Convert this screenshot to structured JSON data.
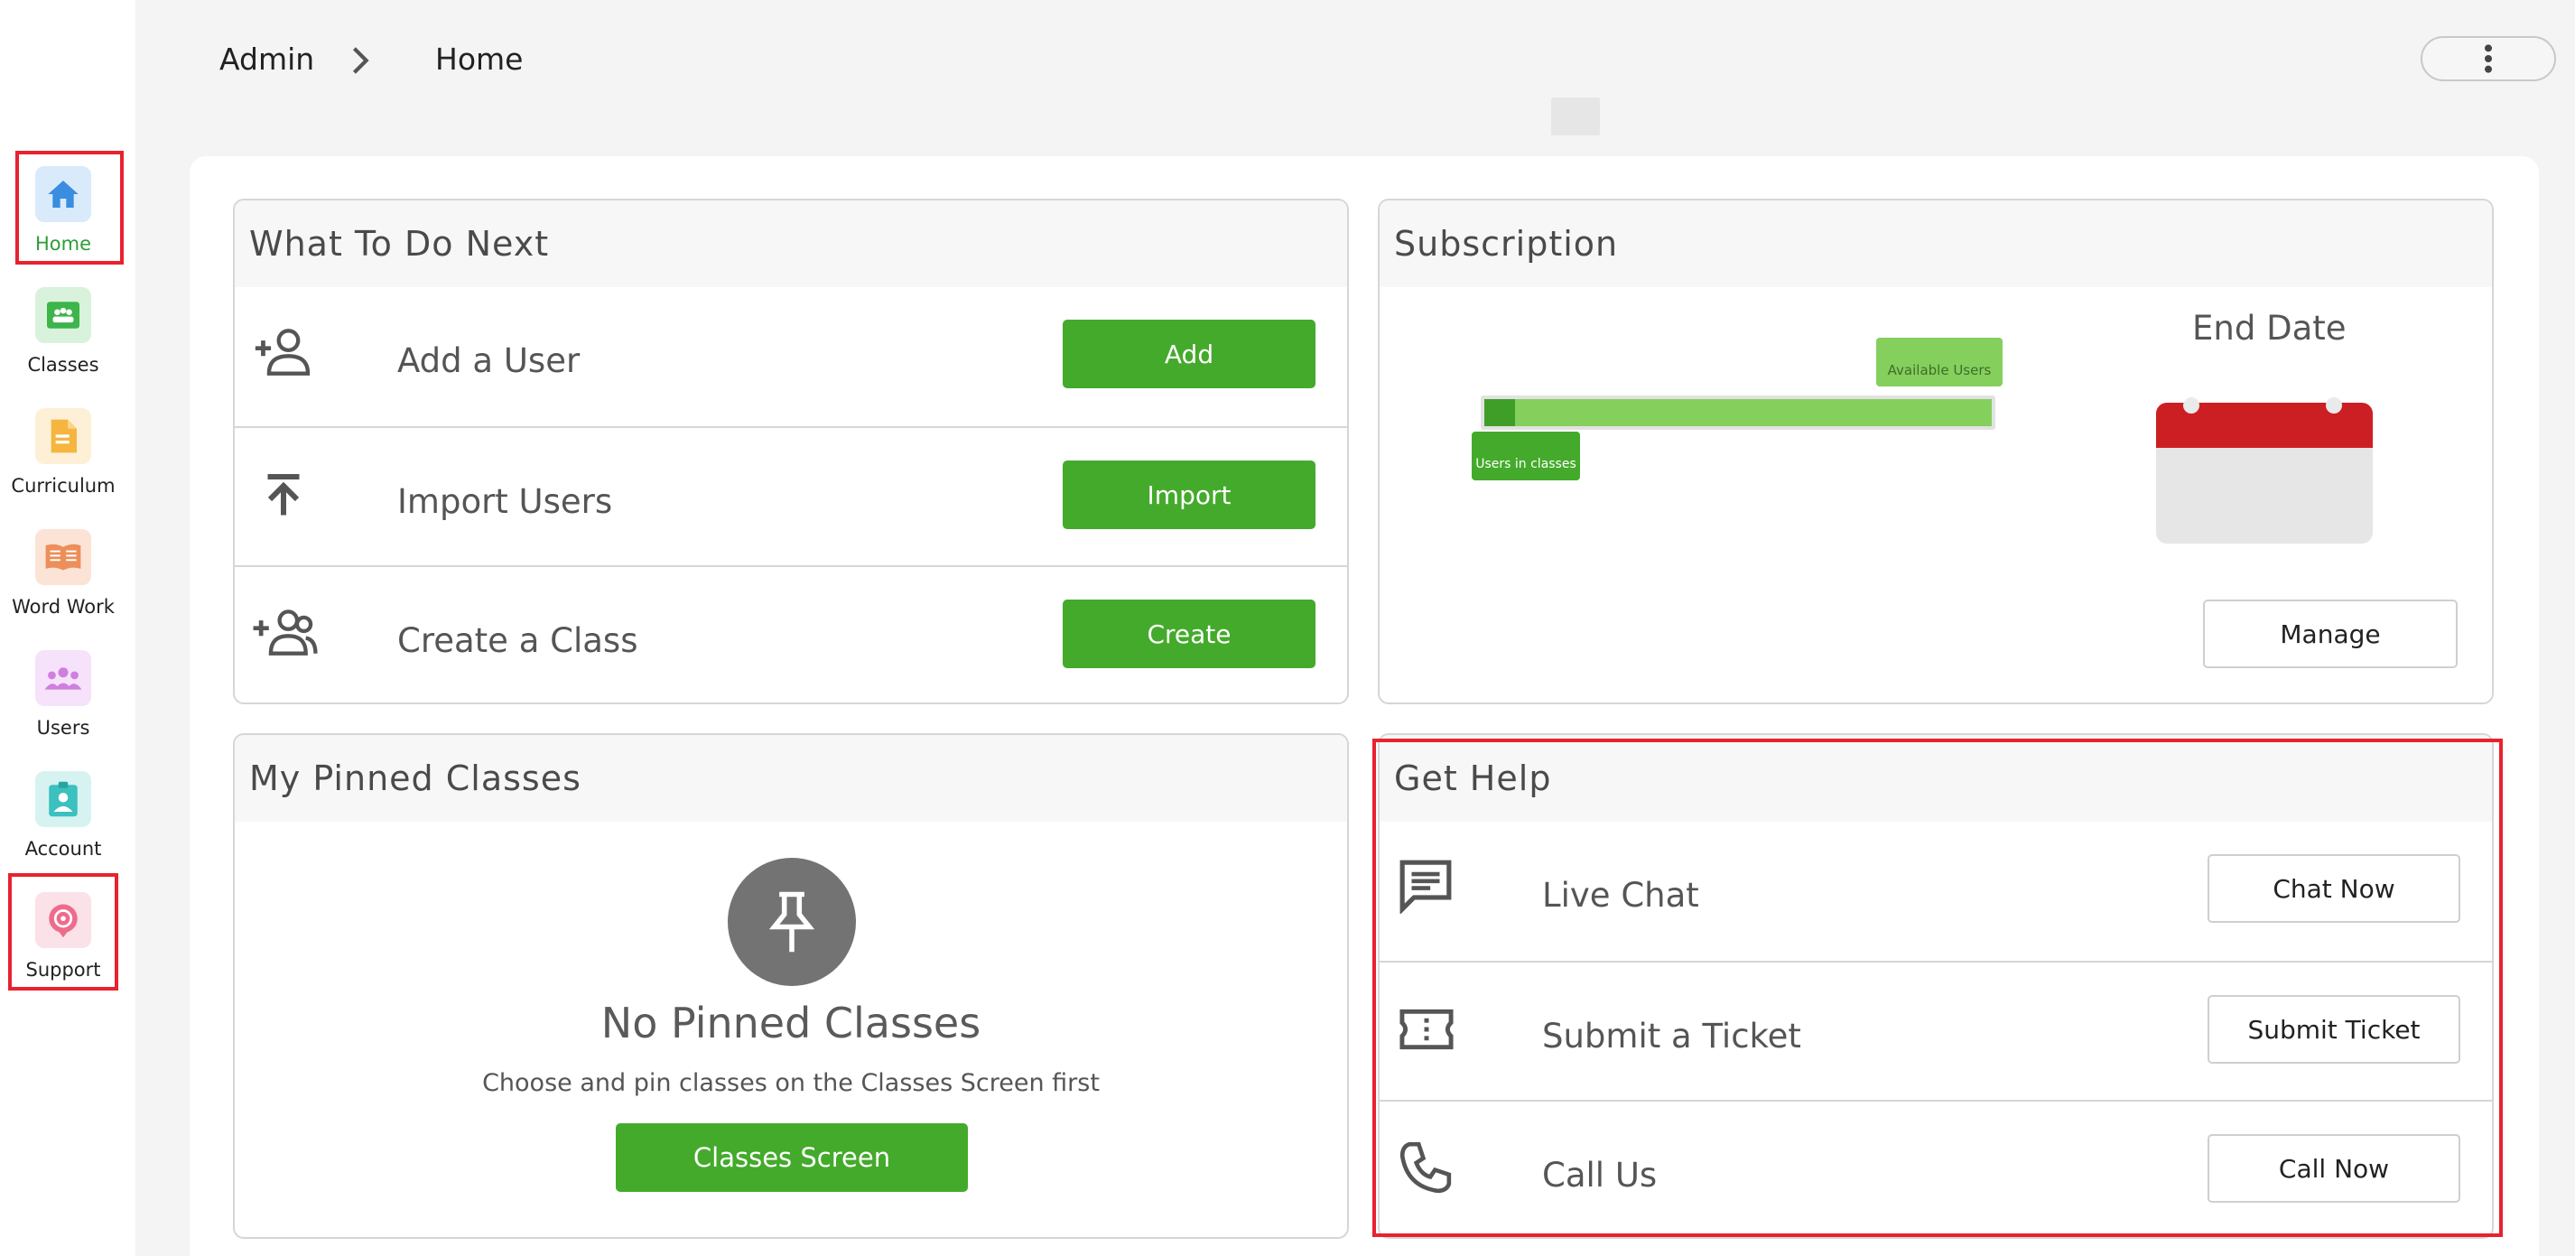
{
  "sidebar": {
    "items": [
      {
        "label": "Home",
        "icon": "home-icon",
        "color": "#3a8de0",
        "bg": "#d9ebfa"
      },
      {
        "label": "Classes",
        "icon": "classes-icon",
        "color": "#3cb54a",
        "bg": "#d9f2dc"
      },
      {
        "label": "Curriculum",
        "icon": "curriculum-icon",
        "color": "#f5b53f",
        "bg": "#fdf0d6"
      },
      {
        "label": "Word Work",
        "icon": "book-icon",
        "color": "#ec8f5a",
        "bg": "#fbe3d6"
      },
      {
        "label": "Users",
        "icon": "users-icon",
        "color": "#d07ee0",
        "bg": "#f6e2fa"
      },
      {
        "label": "Account",
        "icon": "account-icon",
        "color": "#3cc0c0",
        "bg": "#d6f3f2"
      },
      {
        "label": "Support",
        "icon": "support-icon",
        "color": "#ee6b8c",
        "bg": "#fbe1e8"
      }
    ]
  },
  "header": {
    "breadcrumb_root": "Admin",
    "breadcrumb_current": "Home"
  },
  "what_to_do": {
    "title": "What To Do Next",
    "rows": [
      {
        "label": "Add a User",
        "button": "Add",
        "icon": "add-person-icon"
      },
      {
        "label": "Import Users",
        "button": "Import",
        "icon": "upload-icon"
      },
      {
        "label": "Create a Class",
        "button": "Create",
        "icon": "add-group-icon"
      }
    ]
  },
  "subscription": {
    "title": "Subscription",
    "available_users_label": "Available Users",
    "users_in_classes_label": "Users in classes",
    "users_in_classes_fraction": 0.06,
    "end_date_label": "End Date",
    "manage_button": "Manage"
  },
  "pinned": {
    "title": "My Pinned Classes",
    "empty_title": "No Pinned Classes",
    "empty_subtitle": "Choose and pin classes on the Classes Screen first",
    "button": "Classes Screen"
  },
  "help": {
    "title": "Get Help",
    "rows": [
      {
        "label": "Live Chat",
        "button": "Chat Now",
        "icon": "chat-icon"
      },
      {
        "label": "Submit a Ticket",
        "button": "Submit Ticket",
        "icon": "ticket-icon"
      },
      {
        "label": "Call Us",
        "button": "Call Now",
        "icon": "phone-icon"
      }
    ]
  },
  "colors": {
    "accent_green": "#44aa2b",
    "highlight_red": "#e8222e",
    "calendar_red": "#cc1f23"
  }
}
